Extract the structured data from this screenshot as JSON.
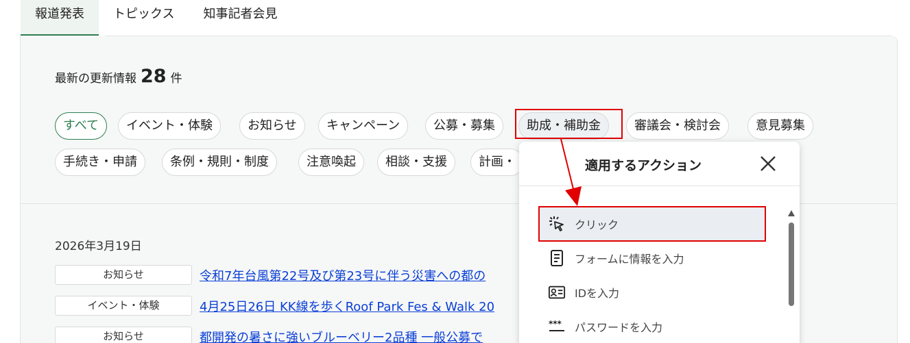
{
  "tabs": [
    {
      "label": "報道発表"
    },
    {
      "label": "トピックス"
    },
    {
      "label": "知事記者会見"
    }
  ],
  "update_info": {
    "prefix": "最新の更新情報",
    "count": "28",
    "suffix": "件"
  },
  "filters": {
    "row1": [
      "すべて",
      "イベント・体験",
      "お知らせ",
      "キャンペーン",
      "公募・募集",
      "助成・補助金",
      "審議会・検討会",
      "意見募集"
    ],
    "row2": [
      "手続き・申請",
      "条例・規則・制度",
      "注意喚起",
      "相談・支援",
      "計画・"
    ]
  },
  "news": {
    "date": "2026年3月19日",
    "items": [
      {
        "category": "お知らせ",
        "title": "令和7年台風第22号及び第23号に伴う災害への都の"
      },
      {
        "category": "イベント・体験",
        "title": "4月25日26日 KK線を歩くRoof Park Fes & Walk 20"
      },
      {
        "category": "お知らせ",
        "title": "都開発の暑さに強いブルーベリー2品種 一般公募で"
      }
    ]
  },
  "action_popup": {
    "title": "適用するアクション",
    "actions": [
      {
        "label": "クリック",
        "icon": "click-icon"
      },
      {
        "label": "フォームに情報を入力",
        "icon": "form-icon"
      },
      {
        "label": "IDを入力",
        "icon": "id-card-icon"
      },
      {
        "label": "パスワードを入力",
        "icon": "password-icon"
      }
    ]
  },
  "colors": {
    "accent_green": "#2e7d4f",
    "link_blue": "#0a3fd6",
    "highlight_red": "#e00000"
  }
}
